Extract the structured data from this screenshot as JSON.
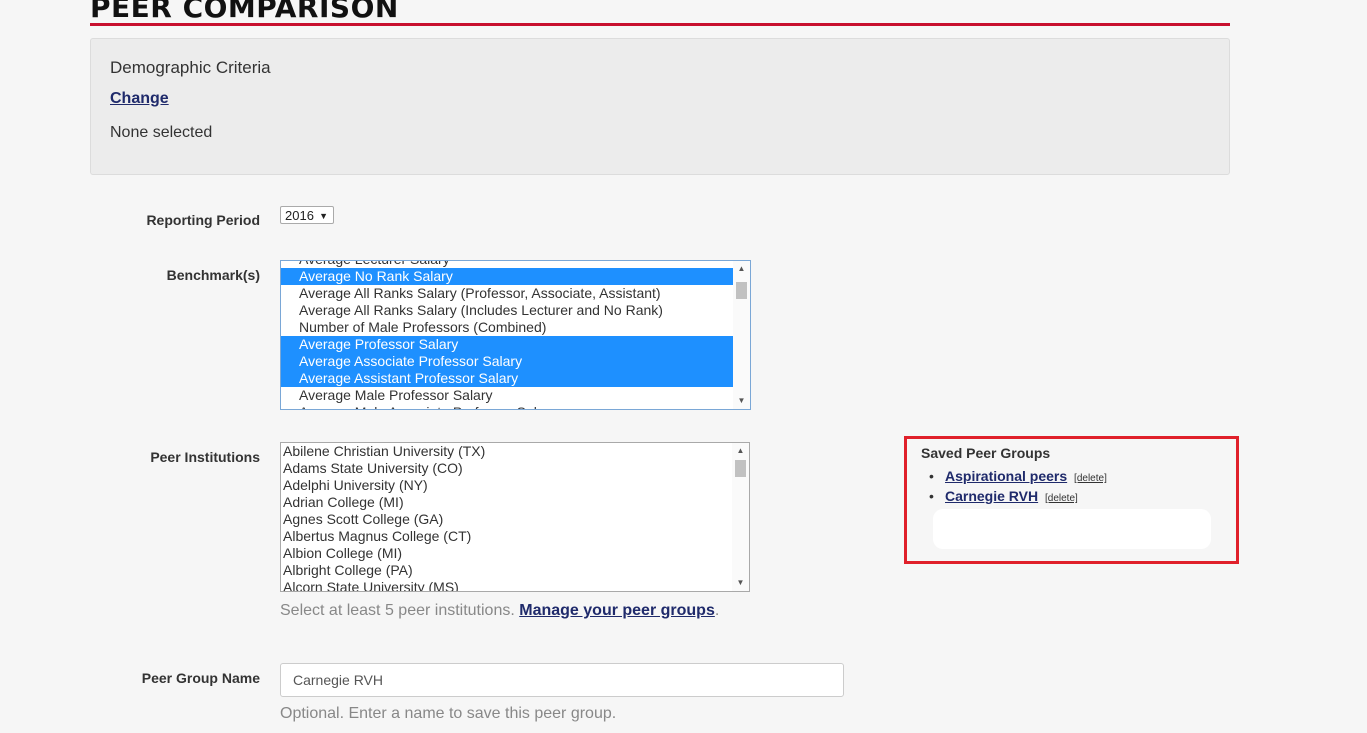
{
  "header": {
    "title": "PEER COMPARISON"
  },
  "criteria": {
    "heading": "Demographic Criteria",
    "change_label": "Change",
    "value": "None selected"
  },
  "reporting_period": {
    "label": "Reporting Period",
    "selected": "2016"
  },
  "benchmarks": {
    "label": "Benchmark(s)",
    "options": [
      {
        "text": "Average Lecturer Salary",
        "selected": false
      },
      {
        "text": "Average No Rank Salary",
        "selected": true
      },
      {
        "text": "Average All Ranks Salary (Professor, Associate, Assistant)",
        "selected": false
      },
      {
        "text": "Average All Ranks Salary (Includes Lecturer and No Rank)",
        "selected": false
      },
      {
        "text": "Number of Male Professors (Combined)",
        "selected": false
      },
      {
        "text": "Average Professor Salary",
        "selected": true
      },
      {
        "text": "Average Associate Professor Salary",
        "selected": true
      },
      {
        "text": "Average Assistant Professor Salary",
        "selected": true
      },
      {
        "text": "Average Male Professor Salary",
        "selected": false
      },
      {
        "text": "Average Male Associate Professor Salary",
        "selected": false
      }
    ]
  },
  "peer_institutions": {
    "label": "Peer Institutions",
    "options": [
      "Abilene Christian University (TX)",
      "Adams State University (CO)",
      "Adelphi University (NY)",
      "Adrian College (MI)",
      "Agnes Scott College (GA)",
      "Albertus Magnus College (CT)",
      "Albion College (MI)",
      "Albright College (PA)",
      "Alcorn State University (MS)"
    ],
    "help_prefix": "Select at least 5 peer institutions.",
    "help_link": "Manage your peer groups",
    "help_suffix": "."
  },
  "peer_group_name": {
    "label": "Peer Group Name",
    "value": "Carnegie RVH",
    "help": "Optional. Enter a name to save this peer group."
  },
  "saved_groups": {
    "title": "Saved Peer Groups",
    "items": [
      {
        "name": "Aspirational peers",
        "delete_label": "[delete]"
      },
      {
        "name": "Carnegie RVH",
        "delete_label": "[delete]"
      }
    ]
  },
  "colors": {
    "accent": "#c8102e",
    "selection": "#1e90ff",
    "link": "#1f2a6b",
    "highlight_border": "#e0202a"
  }
}
